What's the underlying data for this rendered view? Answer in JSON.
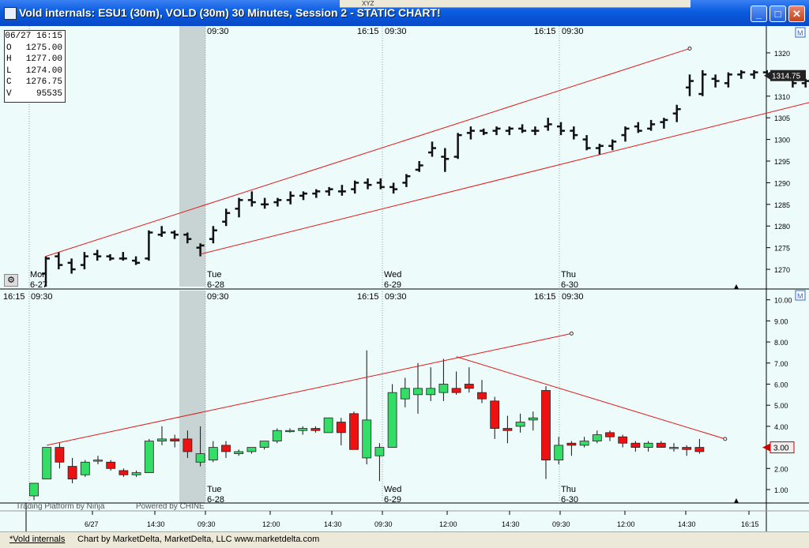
{
  "window": {
    "title": "Vold internals: ESU1 (30m), VOLD (30m) 30 Minutes, Session 2 - STATIC CHART!",
    "toolbar_text": "XYZ",
    "minimize_glyph": "_",
    "maximize_glyph": "□",
    "close_glyph": "✕"
  },
  "status_bar": {
    "label": "*Vold internals",
    "credit": "Chart by MarketDelta, MarketDelta, LLC www.marketdelta.com"
  },
  "ohlc_box": {
    "rows": [
      {
        "k": "",
        "v": "06/27 16:15"
      },
      {
        "k": "O",
        "v": "1275.00"
      },
      {
        "k": "H",
        "v": "1277.00"
      },
      {
        "k": "L",
        "v": "1274.00"
      },
      {
        "k": "C",
        "v": "1276.75"
      },
      {
        "k": "V",
        "v": "95535"
      }
    ]
  },
  "overlay_text": {
    "bottom_panel_watermark": "Trading Platform by Ninja",
    "powered_by": "Powered by CHINE"
  },
  "chart_data": [
    {
      "type": "ohlc",
      "title": "ESU1 (30m)",
      "ylim": [
        1266,
        1324
      ],
      "yticks": [
        1270,
        1275,
        1280,
        1285,
        1290,
        1295,
        1300,
        1305,
        1310,
        1315,
        1320
      ],
      "last_value_label": "1314.75",
      "last_value": 1314.75,
      "time_labels": [
        "16:15",
        "09:30",
        "16:15",
        "09:30",
        "16:15",
        "09:30",
        "16:15",
        "09:30"
      ],
      "day_labels": [
        {
          "day": "Mon",
          "date": "6-27"
        },
        {
          "day": "Tue",
          "date": "6-28"
        },
        {
          "day": "Wed",
          "date": "6-29"
        },
        {
          "day": "Thu",
          "date": "6-30"
        }
      ],
      "bars": [
        {
          "o": 1269,
          "h": 1273,
          "l": 1266,
          "c": 1272.5
        },
        {
          "o": 1273,
          "h": 1274,
          "l": 1270,
          "c": 1271
        },
        {
          "o": 1271.5,
          "h": 1272.5,
          "l": 1269,
          "c": 1270
        },
        {
          "o": 1271,
          "h": 1274,
          "l": 1270,
          "c": 1273
        },
        {
          "o": 1273.5,
          "h": 1274.5,
          "l": 1272,
          "c": 1273
        },
        {
          "o": 1273,
          "h": 1273.5,
          "l": 1272,
          "c": 1272.5
        },
        {
          "o": 1272.5,
          "h": 1274,
          "l": 1272,
          "c": 1272.5
        },
        {
          "o": 1272,
          "h": 1273,
          "l": 1271,
          "c": 1271.5
        },
        {
          "o": 1272.5,
          "h": 1279,
          "l": 1272,
          "c": 1278.5
        },
        {
          "o": 1278,
          "h": 1280,
          "l": 1277.5,
          "c": 1278.5
        },
        {
          "o": 1278.5,
          "h": 1279,
          "l": 1277,
          "c": 1278
        },
        {
          "o": 1278,
          "h": 1278.5,
          "l": 1276,
          "c": 1277
        },
        {
          "o": 1275,
          "h": 1276,
          "l": 1273,
          "c": 1275.5
        },
        {
          "o": 1277,
          "h": 1280,
          "l": 1276,
          "c": 1279
        },
        {
          "o": 1281,
          "h": 1284,
          "l": 1280,
          "c": 1283
        },
        {
          "o": 1284,
          "h": 1286.5,
          "l": 1282,
          "c": 1286
        },
        {
          "o": 1286,
          "h": 1288,
          "l": 1284.5,
          "c": 1285.5
        },
        {
          "o": 1285,
          "h": 1286.5,
          "l": 1284,
          "c": 1285
        },
        {
          "o": 1285.5,
          "h": 1286.5,
          "l": 1284.5,
          "c": 1286
        },
        {
          "o": 1286,
          "h": 1288,
          "l": 1285,
          "c": 1287
        },
        {
          "o": 1287,
          "h": 1288,
          "l": 1286,
          "c": 1287.5
        },
        {
          "o": 1287.5,
          "h": 1288.5,
          "l": 1286.5,
          "c": 1288
        },
        {
          "o": 1288,
          "h": 1289,
          "l": 1287,
          "c": 1288.5
        },
        {
          "o": 1288,
          "h": 1289.5,
          "l": 1287,
          "c": 1288
        },
        {
          "o": 1288.5,
          "h": 1290.5,
          "l": 1287.5,
          "c": 1290
        },
        {
          "o": 1290,
          "h": 1291,
          "l": 1288.5,
          "c": 1289.5
        },
        {
          "o": 1290,
          "h": 1291,
          "l": 1288.5,
          "c": 1289
        },
        {
          "o": 1289,
          "h": 1290,
          "l": 1287.5,
          "c": 1288.5
        },
        {
          "o": 1290,
          "h": 1292,
          "l": 1289,
          "c": 1291.5
        },
        {
          "o": 1293,
          "h": 1295,
          "l": 1292.5,
          "c": 1294
        },
        {
          "o": 1297,
          "h": 1299.5,
          "l": 1296,
          "c": 1298
        },
        {
          "o": 1296,
          "h": 1298,
          "l": 1292.5,
          "c": 1295.5
        },
        {
          "o": 1296,
          "h": 1301.5,
          "l": 1295.5,
          "c": 1301
        },
        {
          "o": 1301.5,
          "h": 1303,
          "l": 1300,
          "c": 1302
        },
        {
          "o": 1302,
          "h": 1302.5,
          "l": 1301,
          "c": 1301.5
        },
        {
          "o": 1302,
          "h": 1303,
          "l": 1301,
          "c": 1302.5
        },
        {
          "o": 1302,
          "h": 1303,
          "l": 1301,
          "c": 1302.5
        },
        {
          "o": 1302.5,
          "h": 1303.5,
          "l": 1301.5,
          "c": 1302
        },
        {
          "o": 1302,
          "h": 1303,
          "l": 1301,
          "c": 1302
        },
        {
          "o": 1303,
          "h": 1305,
          "l": 1302,
          "c": 1303.5
        },
        {
          "o": 1303,
          "h": 1304,
          "l": 1301,
          "c": 1302
        },
        {
          "o": 1302,
          "h": 1303,
          "l": 1300,
          "c": 1301
        },
        {
          "o": 1300,
          "h": 1301,
          "l": 1297.5,
          "c": 1298
        },
        {
          "o": 1298,
          "h": 1299,
          "l": 1296.5,
          "c": 1298.5
        },
        {
          "o": 1298.5,
          "h": 1300,
          "l": 1297.5,
          "c": 1299.5
        },
        {
          "o": 1301,
          "h": 1303,
          "l": 1299.5,
          "c": 1302.5
        },
        {
          "o": 1303,
          "h": 1304,
          "l": 1301.5,
          "c": 1302
        },
        {
          "o": 1302.5,
          "h": 1304.5,
          "l": 1302,
          "c": 1303.5
        },
        {
          "o": 1304,
          "h": 1305,
          "l": 1302.5,
          "c": 1304.5
        },
        {
          "o": 1306,
          "h": 1308,
          "l": 1304,
          "c": 1307
        },
        {
          "o": 1312,
          "h": 1315,
          "l": 1310,
          "c": 1313.5
        },
        {
          "o": 1310.5,
          "h": 1316,
          "l": 1310,
          "c": 1315
        },
        {
          "o": 1314,
          "h": 1315,
          "l": 1312,
          "c": 1313.5
        },
        {
          "o": 1313,
          "h": 1315.5,
          "l": 1312,
          "c": 1315
        },
        {
          "o": 1315,
          "h": 1316,
          "l": 1314,
          "c": 1315.5
        },
        {
          "o": 1315,
          "h": 1316,
          "l": 1314,
          "c": 1315.5
        },
        {
          "o": 1315.5,
          "h": 1316,
          "l": 1314.5,
          "c": 1315
        },
        {
          "o": 1315,
          "h": 1315.5,
          "l": 1314,
          "c": 1314.5
        },
        {
          "o": 1314,
          "h": 1315,
          "l": 1312,
          "c": 1313
        },
        {
          "o": 1313,
          "h": 1314,
          "l": 1312,
          "c": 1313.5
        },
        {
          "o": 1313.5,
          "h": 1314.5,
          "l": 1312.5,
          "c": 1313
        },
        {
          "o": 1313.5,
          "h": 1314.5,
          "l": 1312.5,
          "c": 1313.5
        },
        {
          "o": 1313,
          "h": 1314,
          "l": 1312,
          "c": 1313.5
        },
        {
          "o": 1313.5,
          "h": 1314.5,
          "l": 1312.5,
          "c": 1313
        },
        {
          "o": 1313,
          "h": 1314,
          "l": 1311.5,
          "c": 1313.5
        },
        {
          "o": 1314,
          "h": 1317,
          "l": 1313,
          "c": 1315
        },
        {
          "o": 1315,
          "h": 1316,
          "l": 1314,
          "c": 1314.75
        }
      ],
      "trendlines": [
        {
          "from": [
            0,
            1273
          ],
          "to": [
            50,
            1321
          ]
        },
        {
          "from": [
            12,
            1273.5
          ],
          "to": [
            68,
            1315
          ]
        }
      ]
    },
    {
      "type": "candlestick",
      "title": "VOLD (30m)",
      "ylim": [
        0.4,
        10.4
      ],
      "yticks": [
        1,
        2,
        3,
        4,
        5,
        6,
        7,
        8,
        9,
        10
      ],
      "last_value_label": "3.00",
      "last_value": 3.0,
      "time_labels": [
        "16:15",
        "09:30",
        "16:15",
        "09:30",
        "16:15",
        "09:30"
      ],
      "date_labels": [
        "6/27",
        "Tue 6-28",
        "Wed 6-29",
        "Thu 6-30"
      ],
      "bottom_labels": [
        "6/27",
        "14:30",
        "09:30",
        "12:00",
        "14:30",
        "09:30",
        "12:00",
        "14:30",
        "09:30",
        "12:00",
        "14:30",
        "16:15"
      ],
      "candles": [
        {
          "o": 0.7,
          "h": 1.3,
          "l": 0.5,
          "c": 1.3
        },
        {
          "o": 1.5,
          "h": 3.0,
          "l": 1.5,
          "c": 3.0
        },
        {
          "o": 3.0,
          "h": 3.2,
          "l": 2.0,
          "c": 2.3
        },
        {
          "o": 2.1,
          "h": 2.5,
          "l": 1.3,
          "c": 1.5
        },
        {
          "o": 1.7,
          "h": 2.4,
          "l": 1.6,
          "c": 2.3
        },
        {
          "o": 2.4,
          "h": 2.6,
          "l": 2.2,
          "c": 2.4
        },
        {
          "o": 2.3,
          "h": 2.4,
          "l": 1.9,
          "c": 2.0
        },
        {
          "o": 1.9,
          "h": 2.0,
          "l": 1.6,
          "c": 1.7
        },
        {
          "o": 1.7,
          "h": 1.9,
          "l": 1.6,
          "c": 1.8
        },
        {
          "o": 1.8,
          "h": 3.4,
          "l": 1.8,
          "c": 3.3
        },
        {
          "o": 3.3,
          "h": 4.0,
          "l": 3.1,
          "c": 3.4
        },
        {
          "o": 3.4,
          "h": 3.6,
          "l": 3.0,
          "c": 3.3
        },
        {
          "o": 3.4,
          "h": 3.8,
          "l": 2.5,
          "c": 2.8
        },
        {
          "o": 2.3,
          "h": 4.0,
          "l": 2.1,
          "c": 2.7
        },
        {
          "o": 2.4,
          "h": 3.3,
          "l": 2.3,
          "c": 3.0
        },
        {
          "o": 3.1,
          "h": 3.3,
          "l": 2.5,
          "c": 2.8
        },
        {
          "o": 2.7,
          "h": 2.9,
          "l": 2.6,
          "c": 2.8
        },
        {
          "o": 2.8,
          "h": 3.0,
          "l": 2.7,
          "c": 3.0
        },
        {
          "o": 3.0,
          "h": 3.2,
          "l": 2.9,
          "c": 3.3
        },
        {
          "o": 3.3,
          "h": 3.9,
          "l": 3.2,
          "c": 3.8
        },
        {
          "o": 3.8,
          "h": 3.9,
          "l": 3.7,
          "c": 3.8
        },
        {
          "o": 3.8,
          "h": 4.0,
          "l": 3.6,
          "c": 3.9
        },
        {
          "o": 3.9,
          "h": 4.0,
          "l": 3.7,
          "c": 3.8
        },
        {
          "o": 3.7,
          "h": 4.4,
          "l": 3.7,
          "c": 4.4
        },
        {
          "o": 4.2,
          "h": 4.4,
          "l": 3.1,
          "c": 3.7
        },
        {
          "o": 4.6,
          "h": 4.7,
          "l": 2.9,
          "c": 2.9
        },
        {
          "o": 2.5,
          "h": 7.6,
          "l": 2.2,
          "c": 4.3
        },
        {
          "o": 2.6,
          "h": 3.2,
          "l": 1.4,
          "c": 3.0
        },
        {
          "o": 3.0,
          "h": 6.0,
          "l": 3.0,
          "c": 5.6
        },
        {
          "o": 5.3,
          "h": 6.3,
          "l": 4.9,
          "c": 5.8
        },
        {
          "o": 5.5,
          "h": 7.0,
          "l": 4.6,
          "c": 5.8
        },
        {
          "o": 5.5,
          "h": 6.8,
          "l": 5.2,
          "c": 5.8
        },
        {
          "o": 5.6,
          "h": 7.2,
          "l": 5.2,
          "c": 6.0
        },
        {
          "o": 5.8,
          "h": 6.6,
          "l": 5.5,
          "c": 5.6
        },
        {
          "o": 6.0,
          "h": 6.8,
          "l": 5.6,
          "c": 5.8
        },
        {
          "o": 5.6,
          "h": 6.2,
          "l": 5.1,
          "c": 5.3
        },
        {
          "o": 5.2,
          "h": 5.4,
          "l": 3.4,
          "c": 3.9
        },
        {
          "o": 3.9,
          "h": 4.5,
          "l": 3.2,
          "c": 3.8
        },
        {
          "o": 4.0,
          "h": 4.6,
          "l": 3.7,
          "c": 4.2
        },
        {
          "o": 4.3,
          "h": 4.7,
          "l": 3.8,
          "c": 4.4
        },
        {
          "o": 5.7,
          "h": 5.9,
          "l": 1.5,
          "c": 2.4
        },
        {
          "o": 2.4,
          "h": 3.5,
          "l": 2.2,
          "c": 3.1
        },
        {
          "o": 3.2,
          "h": 3.3,
          "l": 2.6,
          "c": 3.1
        },
        {
          "o": 3.1,
          "h": 3.5,
          "l": 3.0,
          "c": 3.3
        },
        {
          "o": 3.3,
          "h": 3.8,
          "l": 3.2,
          "c": 3.6
        },
        {
          "o": 3.7,
          "h": 3.8,
          "l": 3.3,
          "c": 3.5
        },
        {
          "o": 3.5,
          "h": 3.6,
          "l": 3.0,
          "c": 3.2
        },
        {
          "o": 3.2,
          "h": 3.3,
          "l": 2.8,
          "c": 3.0
        },
        {
          "o": 3.0,
          "h": 3.3,
          "l": 2.8,
          "c": 3.2
        },
        {
          "o": 3.2,
          "h": 3.3,
          "l": 3.0,
          "c": 3.0
        },
        {
          "o": 3.0,
          "h": 3.2,
          "l": 2.8,
          "c": 3.0
        },
        {
          "o": 3.0,
          "h": 3.1,
          "l": 2.6,
          "c": 2.9
        },
        {
          "o": 3.0,
          "h": 3.4,
          "l": 2.7,
          "c": 2.8
        }
      ],
      "trendlines": [
        {
          "from": [
            1,
            3.1
          ],
          "to": [
            42,
            8.4
          ]
        },
        {
          "from": [
            33,
            7.3
          ],
          "to": [
            54,
            3.4
          ]
        }
      ]
    }
  ],
  "colors": {
    "background": "#eefbfb",
    "up_candle": "#33dd66",
    "down_candle": "#ee1111",
    "trendline": "#e01818",
    "bar": "#111111",
    "highlight": "#c8d4d4",
    "grid": "#777777"
  }
}
